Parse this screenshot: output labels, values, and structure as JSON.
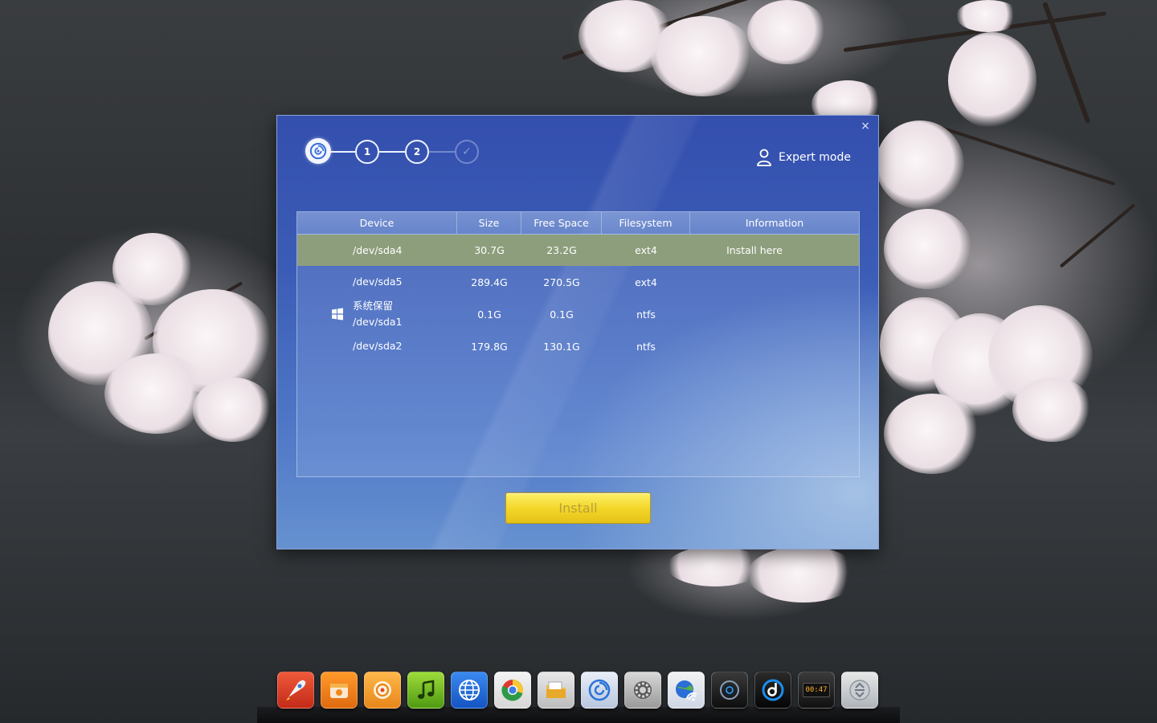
{
  "installer": {
    "close_label": "×",
    "steps": [
      {
        "label": "1"
      },
      {
        "label": "2"
      },
      {
        "label": "✓"
      }
    ],
    "expert_mode_label": "Expert mode",
    "table": {
      "headers": [
        "Device",
        "Size",
        "Free Space",
        "Filesystem",
        "Information"
      ],
      "rows": [
        {
          "label": "",
          "device": "/dev/sda4",
          "size": "30.7G",
          "free": "23.2G",
          "fs": "ext4",
          "info": "Install here",
          "selected": true,
          "icon": ""
        },
        {
          "label": "",
          "device": "/dev/sda5",
          "size": "289.4G",
          "free": "270.5G",
          "fs": "ext4",
          "info": "",
          "selected": false,
          "icon": ""
        },
        {
          "label": "系统保留",
          "device": "/dev/sda1",
          "size": "0.1G",
          "free": "0.1G",
          "fs": "ntfs",
          "info": "",
          "selected": false,
          "icon": "windows-icon"
        },
        {
          "label": "",
          "device": "/dev/sda2",
          "size": "179.8G",
          "free": "130.1G",
          "fs": "ntfs",
          "info": "",
          "selected": false,
          "icon": ""
        }
      ]
    },
    "install_label": "Install"
  },
  "dock": {
    "apps": [
      {
        "name": "launcher-icon"
      },
      {
        "name": "store-icon"
      },
      {
        "name": "game-center-icon"
      },
      {
        "name": "music-player-icon"
      },
      {
        "name": "browser-globe-icon"
      },
      {
        "name": "chrome-icon"
      },
      {
        "name": "file-manager-icon"
      },
      {
        "name": "deepin-installer-icon"
      },
      {
        "name": "system-settings-icon"
      },
      {
        "name": "network-icon"
      },
      {
        "name": "camera-icon"
      },
      {
        "name": "media-player-icon"
      },
      {
        "name": "clock-icon"
      },
      {
        "name": "trash-icon"
      }
    ],
    "clock_time": "00:47"
  },
  "colors": {
    "selected_row": "#8d9e7c",
    "install_button": "#f3d72a",
    "window_blue": "#3b5cb6"
  }
}
